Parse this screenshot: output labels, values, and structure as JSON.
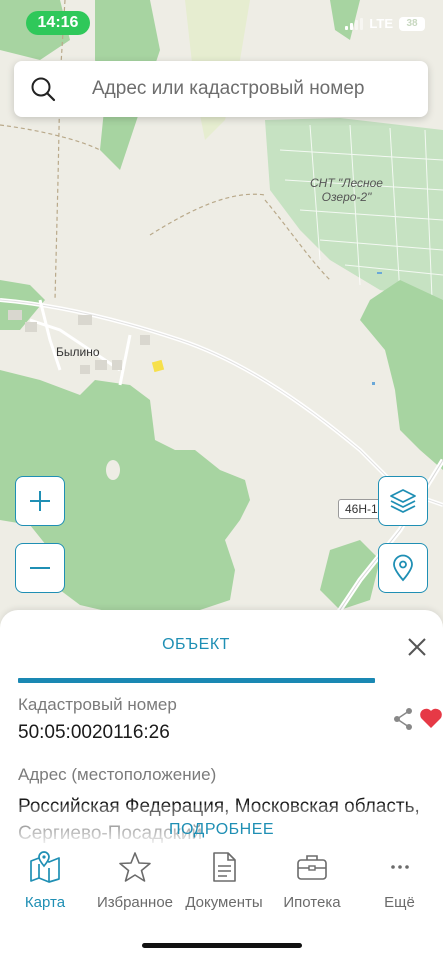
{
  "status_bar": {
    "time": "14:16",
    "network": "LTE",
    "battery": "38"
  },
  "search": {
    "placeholder": "Адрес или кадастровый номер"
  },
  "map": {
    "labels": {
      "settlement": "Былино",
      "snt_line1": "СНТ \"Лесное",
      "snt_line2": "Озеро-2\"",
      "road": "46Н-1"
    },
    "colors": {
      "land": "#eeede5",
      "forest": "#a7d4a1",
      "road": "#ffffff",
      "accent": "#1f8fb4"
    }
  },
  "map_controls": {
    "zoom_in": "+",
    "zoom_out": "−",
    "layers_icon": "layers-icon",
    "location_icon": "location-pin-icon"
  },
  "sheet": {
    "tab_label": "ОБЪЕКТ",
    "cadastral_label": "Кадастровый номер",
    "cadastral_value": "50:05:0020116:26",
    "address_label": "Адрес (местоположение)",
    "address_value": "Российская Федерация, Московская область, Сергиево-Посадский",
    "more_label": "ПОДРОБНЕЕ",
    "favorite_color": "#e63946"
  },
  "tabbar": {
    "items": [
      {
        "label": "Карта",
        "icon": "map-icon",
        "active": true
      },
      {
        "label": "Избранное",
        "icon": "star-icon",
        "active": false
      },
      {
        "label": "Документы",
        "icon": "document-icon",
        "active": false
      },
      {
        "label": "Ипотека",
        "icon": "briefcase-icon",
        "active": false
      },
      {
        "label": "Ещё",
        "icon": "more-icon",
        "active": false
      }
    ]
  }
}
